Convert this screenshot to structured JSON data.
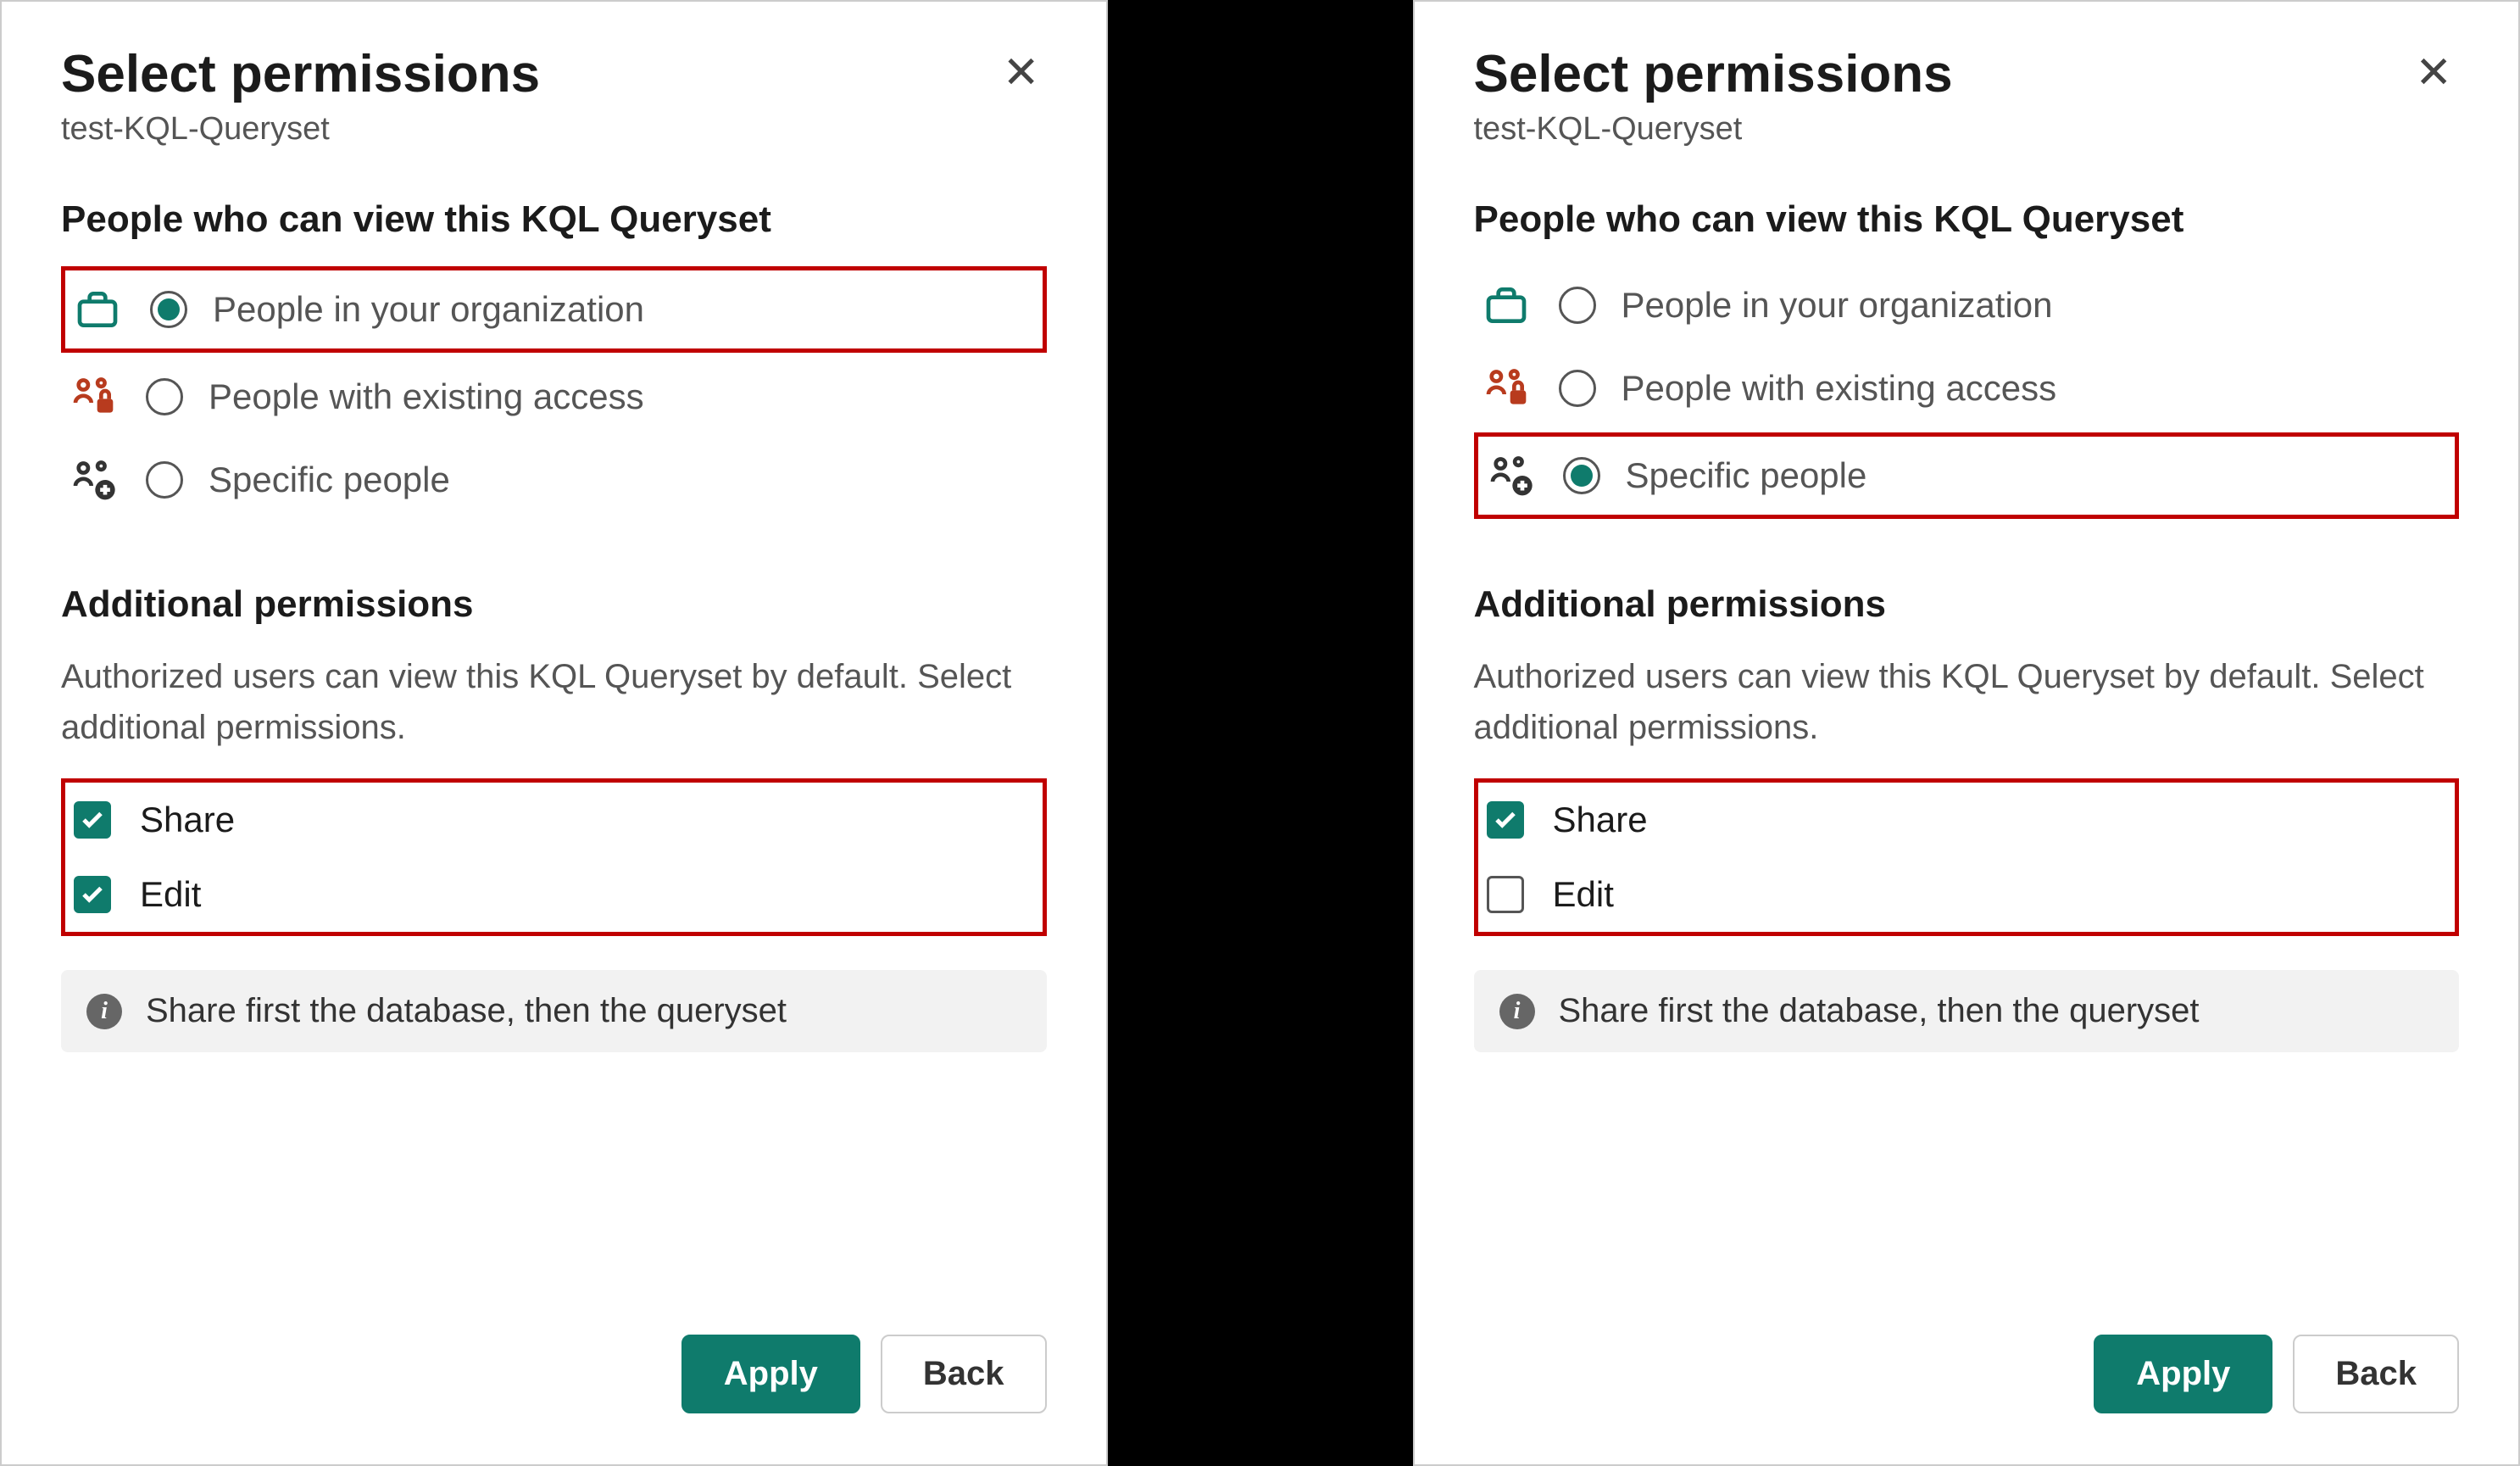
{
  "left": {
    "title": "Select permissions",
    "subtitle": "test-KQL-Queryset",
    "section1_heading": "People who can view this KQL Queryset",
    "radios": [
      {
        "label": "People in your organization",
        "selected": true,
        "highlighted": true
      },
      {
        "label": "People with existing access",
        "selected": false,
        "highlighted": false
      },
      {
        "label": "Specific people",
        "selected": false,
        "highlighted": false
      }
    ],
    "section2_heading": "Additional permissions",
    "helper": "Authorized users can view this KQL Queryset by default. Select additional permissions.",
    "checkboxes_highlighted": true,
    "checkboxes": [
      {
        "label": "Share",
        "checked": true
      },
      {
        "label": "Edit",
        "checked": true
      }
    ],
    "info": "Share first the database, then the queryset",
    "apply": "Apply",
    "back": "Back"
  },
  "right": {
    "title": "Select permissions",
    "subtitle": "test-KQL-Queryset",
    "section1_heading": "People who can view this KQL Queryset",
    "radios": [
      {
        "label": "People in your organization",
        "selected": false,
        "highlighted": false
      },
      {
        "label": "People with existing access",
        "selected": false,
        "highlighted": false
      },
      {
        "label": "Specific people",
        "selected": true,
        "highlighted": true
      }
    ],
    "section2_heading": "Additional permissions",
    "helper": "Authorized users can view this KQL Queryset by default. Select additional permissions.",
    "checkboxes_highlighted": true,
    "checkboxes": [
      {
        "label": "Share",
        "checked": true
      },
      {
        "label": "Edit",
        "checked": false
      }
    ],
    "info": "Share first the database, then the queryset",
    "apply": "Apply",
    "back": "Back"
  }
}
